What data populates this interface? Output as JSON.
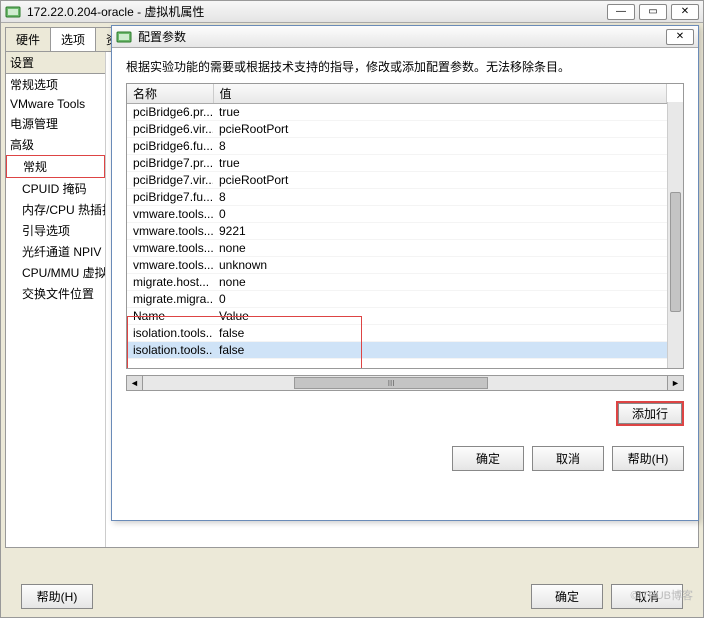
{
  "window": {
    "title": "172.22.0.204-oracle - 虚拟机属性"
  },
  "tabs": {
    "hardware": "硬件",
    "options": "选项",
    "resources": "资"
  },
  "sidebar": {
    "header": "设置",
    "items": [
      {
        "label": "常规选项",
        "indent": false
      },
      {
        "label": "VMware Tools",
        "indent": false
      },
      {
        "label": "电源管理",
        "indent": false
      },
      {
        "label": "高级",
        "indent": false
      },
      {
        "label": "常规",
        "indent": true,
        "selected": true
      },
      {
        "label": "CPUID 掩码",
        "indent": true
      },
      {
        "label": "内存/CPU 热插拔",
        "indent": true
      },
      {
        "label": "引导选项",
        "indent": true
      },
      {
        "label": "光纤通道 NPIV",
        "indent": true
      },
      {
        "label": "CPU/MMU 虚拟化",
        "indent": true
      },
      {
        "label": "交换文件位置",
        "indent": true
      }
    ]
  },
  "footer": {
    "help": "帮助(H)",
    "ok": "确定",
    "cancel": "取消"
  },
  "dialog": {
    "title": "配置参数",
    "info": "根据实验功能的需要或根据技术支持的指导，修改或添加配置参数。无法移除条目。",
    "cols": {
      "name": "名称",
      "value": "值"
    },
    "rows": [
      {
        "name": "pciBridge6.pr...",
        "value": "true"
      },
      {
        "name": "pciBridge6.vir...",
        "value": "pcieRootPort"
      },
      {
        "name": "pciBridge6.fu...",
        "value": "8"
      },
      {
        "name": "pciBridge7.pr...",
        "value": "true"
      },
      {
        "name": "pciBridge7.vir...",
        "value": "pcieRootPort"
      },
      {
        "name": "pciBridge7.fu...",
        "value": "8"
      },
      {
        "name": "vmware.tools....",
        "value": "0"
      },
      {
        "name": "vmware.tools....",
        "value": "9221"
      },
      {
        "name": "vmware.tools....",
        "value": "none"
      },
      {
        "name": "vmware.tools....",
        "value": "unknown"
      },
      {
        "name": "migrate.host...",
        "value": "none"
      },
      {
        "name": "migrate.migra...",
        "value": "0"
      },
      {
        "name": "Name",
        "value": "Value"
      },
      {
        "name": "isolation.tools...",
        "value": "false"
      },
      {
        "name": "isolation.tools...",
        "value": "false",
        "selected": true
      }
    ],
    "add_row": "添加行",
    "ok": "确定",
    "cancel": "取消",
    "help": "帮助(H)"
  },
  "watermark": "©ITPUB博客"
}
